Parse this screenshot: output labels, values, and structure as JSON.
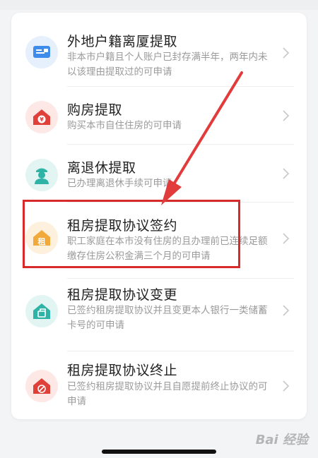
{
  "items": [
    {
      "title": "外地户籍离厦提取",
      "desc": "非本市户籍且个人账户已封存满半年，两年内未以该理由提取过的可申请",
      "icon": "id-card-icon",
      "color": "#3d8bea"
    },
    {
      "title": "购房提取",
      "desc": "购买本市自住住房的可申请",
      "icon": "house-yen-icon",
      "color": "#e0403a"
    },
    {
      "title": "离退休提取",
      "desc": "已办理离退休手续可申请",
      "icon": "retiree-icon",
      "color": "#2fb3a6"
    },
    {
      "title": "租房提取协议签约",
      "desc": "职工家庭在本市没有住房的且办理前已连续足额缴存住房公积金满三个月的可申请",
      "icon": "house-rent-icon",
      "glyph": "租",
      "color": "#f2a93b"
    },
    {
      "title": "租房提取协议变更",
      "desc": "已签约租房提取协议并且变更本人银行一类储蓄卡号的可申请",
      "icon": "house-change-icon",
      "color": "#2fb3a6"
    },
    {
      "title": "租房提取协议终止",
      "desc": "已签约租房提取协议并且自愿提前终止协议的可申请",
      "icon": "house-stop-icon",
      "color": "#e0403a"
    }
  ],
  "watermark": "Bai 经验"
}
